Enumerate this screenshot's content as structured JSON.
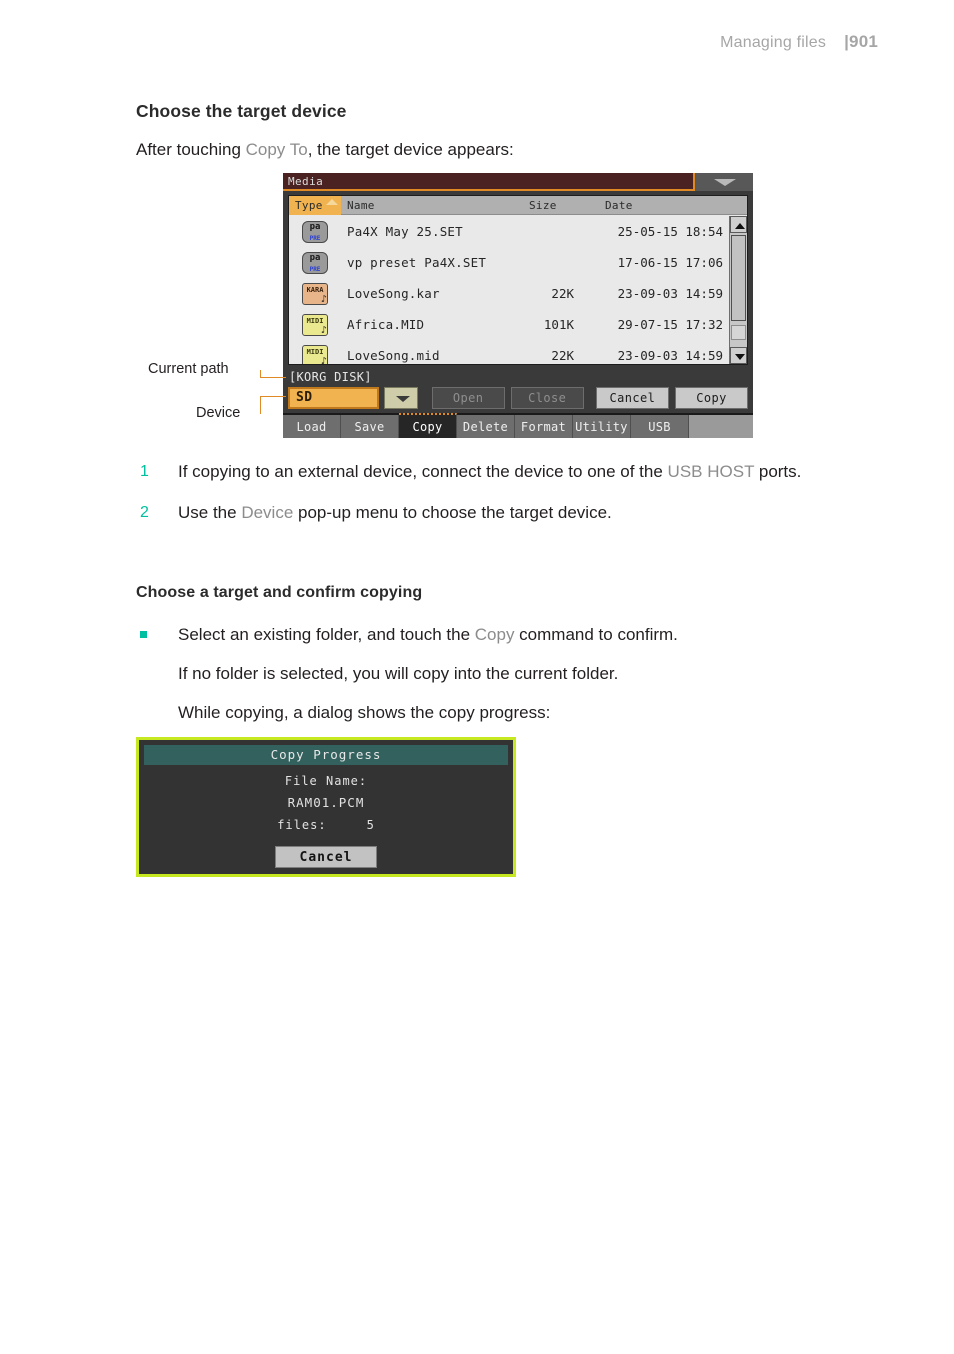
{
  "header": {
    "section": "Managing files",
    "page": "|901"
  },
  "section": {
    "title": "Choose the target device",
    "intro_a": "After touching ",
    "intro_kw": "Copy To",
    "intro_b": ", the target device appears:"
  },
  "screen": {
    "window_title": "Media",
    "columns": {
      "type": "Type",
      "name": "Name",
      "size": "Size",
      "date": "Date"
    },
    "files": [
      {
        "icon": "pa-file-icon",
        "icon_label": "pa",
        "icon_sub": "PRE",
        "name": "Pa4X May 25.SET",
        "size": "",
        "date": "25-05-15 18:54"
      },
      {
        "icon": "pa-file-icon",
        "icon_label": "pa",
        "icon_sub": "PRE",
        "name": "vp preset Pa4X.SET",
        "size": "",
        "date": "17-06-15 17:06"
      },
      {
        "icon": "kar-file-icon",
        "icon_label": "KARA",
        "icon_sub": "",
        "name": "LoveSong.kar",
        "size": "22K",
        "date": "23-09-03 14:59"
      },
      {
        "icon": "midi-file-icon",
        "icon_label": "MIDI",
        "icon_sub": "",
        "name": "Africa.MID",
        "size": "101K",
        "date": "29-07-15 17:32"
      },
      {
        "icon": "midi-file-icon",
        "icon_label": "MIDI",
        "icon_sub": "",
        "name": "LoveSong.mid",
        "size": "22K",
        "date": "23-09-03 14:59"
      }
    ],
    "current_path": "[KORG DISK]",
    "device_value": "SD",
    "buttons": {
      "open": "Open",
      "close": "Close",
      "cancel": "Cancel",
      "copy": "Copy"
    },
    "tabs": [
      "Load",
      "Save",
      "Copy",
      "Delete",
      "Format",
      "Utility",
      "USB"
    ],
    "selected_tab": "Copy"
  },
  "callouts": {
    "current_path": "Current path",
    "device": "Device"
  },
  "steps": [
    {
      "num": "1",
      "a": "If copying to an external device, connect the device to one of the ",
      "kw": "USB HOST",
      "b": " ports."
    },
    {
      "num": "2",
      "a": "Use the ",
      "kw": "Device",
      "b": " pop-up menu to choose the target device."
    }
  ],
  "subsection": {
    "title": "Choose a target and confirm copying",
    "bullet_a": "Select an existing folder, and touch the ",
    "bullet_kw": "Copy",
    "bullet_b": " command to confirm.",
    "line2": "If no folder is selected, you will copy into the current folder.",
    "line3": "While copying, a dialog shows the copy progress:"
  },
  "dialog": {
    "title": "Copy Progress",
    "file_name_label": "File Name:",
    "file_name_value": "RAM01.PCM",
    "files_label": "files:",
    "files_value": "5",
    "cancel": "Cancel"
  },
  "colors": {
    "accent_teal": "#00bfa0",
    "orange": "#e08a25",
    "dialog_border": "#c5e821",
    "dialog_title_bg": "#33615e",
    "title_bar": "#4a2222"
  }
}
